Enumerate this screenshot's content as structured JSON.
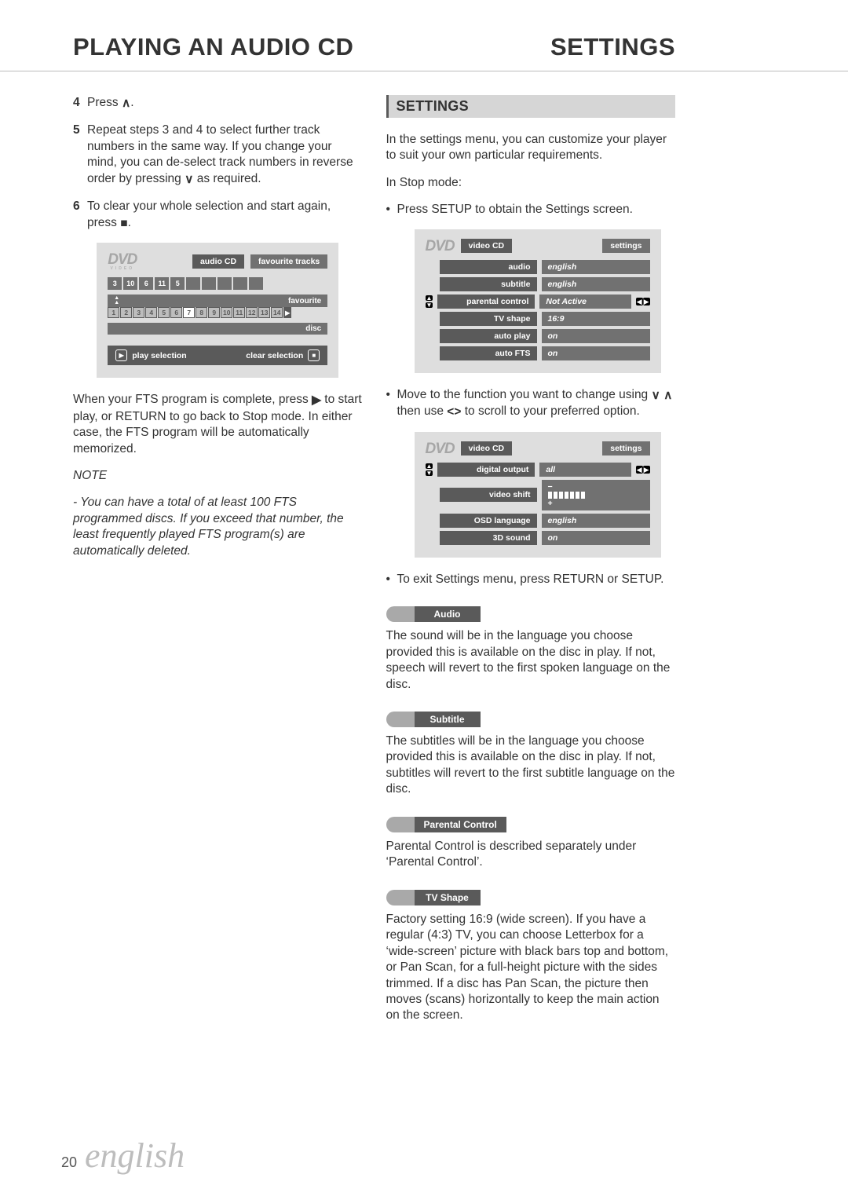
{
  "header": {
    "title_left": "PLAYING AN AUDIO CD",
    "title_right": "SETTINGS"
  },
  "left": {
    "steps": [
      {
        "n": "4",
        "text_pre": "Press ",
        "glyph": "∧",
        "text_post": "."
      },
      {
        "n": "5",
        "text_pre": "Repeat steps 3 and 4 to select further track numbers in the same way. If you change your mind, you can de-select track numbers in reverse order by pressing ",
        "glyph": "∨",
        "text_post": " as required."
      },
      {
        "n": "6",
        "text_pre": "To clear your whole selection and start again, press ",
        "glyph": "■",
        "text_post": "."
      }
    ],
    "osd_audio": {
      "logo": "DVD",
      "logo_sub": "VIDEO",
      "tag1": "audio CD",
      "tag2": "favourite tracks",
      "fav_cells": [
        "3",
        "10",
        "6",
        "11",
        "5",
        "",
        "",
        "",
        "",
        ""
      ],
      "fav_label": "favourite",
      "disc_cells": [
        "1",
        "2",
        "3",
        "4",
        "5",
        "6",
        "7",
        "8",
        "9",
        "10",
        "11",
        "12",
        "13",
        "14"
      ],
      "disc_label": "disc",
      "play_label": "play selection",
      "clear_label": "clear selection"
    },
    "after_osd_pre": "When your FTS program is complete, press ",
    "after_osd_glyph": "▶",
    "after_osd_post": " to start play, or RETURN to go back to Stop mode. In either case, the FTS program will be automatically memorized.",
    "note_h": "NOTE",
    "note_b": "- You can have a total of at least 100 FTS programmed discs. If you exceed that number, the least frequently played FTS program(s) are automatically deleted."
  },
  "right": {
    "section": "SETTINGS",
    "intro": "In the settings menu, you can customize your player to suit your own particular requirements.",
    "stop_mode": "In Stop mode:",
    "bul1": "Press SETUP to obtain the Settings screen.",
    "osd1": {
      "logo": "DVD",
      "tag_l": "video CD",
      "tag_r": "settings",
      "rows": [
        {
          "label": "audio",
          "value": "english",
          "sel": false
        },
        {
          "label": "subtitle",
          "value": "english",
          "sel": false
        },
        {
          "label": "parental control",
          "value": "Not Active",
          "sel": true
        },
        {
          "label": "TV shape",
          "value": "16:9",
          "sel": false
        },
        {
          "label": "auto play",
          "value": "on",
          "sel": false
        },
        {
          "label": "auto FTS",
          "value": "on",
          "sel": false
        }
      ]
    },
    "bul2_pre": "Move to the function you want to change using ",
    "bul2_g1": "∨",
    "bul2_g2": "∧",
    "bul2_mid": " then use ",
    "bul2_g3": "<",
    "bul2_g4": ">",
    "bul2_post": " to scroll to your preferred option.",
    "osd2": {
      "logo": "DVD",
      "tag_l": "video CD",
      "tag_r": "settings",
      "rows": [
        {
          "label": "digital output",
          "value": "all",
          "sel": true,
          "kind": "text"
        },
        {
          "label": "video shift",
          "value": "",
          "sel": false,
          "kind": "shift"
        },
        {
          "label": "OSD language",
          "value": "english",
          "sel": false,
          "kind": "text"
        },
        {
          "label": "3D sound",
          "value": "on",
          "sel": false,
          "kind": "text"
        }
      ],
      "shift_minus": "−",
      "shift_plus": "+"
    },
    "bul3": "To exit Settings menu, press RETURN or SETUP.",
    "pills": [
      {
        "name": "Audio",
        "text": "The sound will be in the language you choose provided this is available on the disc in play. If not, speech will revert to the first spoken language on the disc."
      },
      {
        "name": "Subtitle",
        "text": "The subtitles will be in the language you choose provided this is available on the disc in play. If not, subtitles will revert to the first subtitle language on the disc."
      },
      {
        "name": "Parental Control",
        "text": "Parental Control is described separately under ‘Parental Control’."
      },
      {
        "name": "TV Shape",
        "text": "Factory setting 16:9 (wide screen). If you have a regular (4:3) TV, you can choose Letterbox for a ‘wide-screen’ picture with black bars top and bottom, or Pan Scan, for a full-height picture with the sides trimmed. If a disc has Pan Scan, the picture then moves (scans) horizontally to keep the main action on the screen."
      }
    ]
  },
  "footer": {
    "page": "20",
    "lang": "english"
  }
}
